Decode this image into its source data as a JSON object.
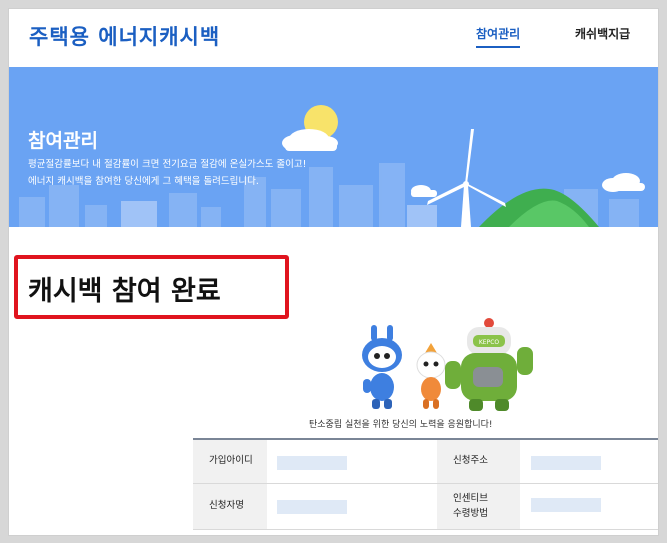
{
  "header": {
    "logo": "주택용 에너지캐시백",
    "nav": [
      {
        "label": "참여관리",
        "active": true
      },
      {
        "label": "캐쉬백지급",
        "active": false
      }
    ]
  },
  "banner": {
    "title": "참여관리",
    "line1": "평균절감률보다 내 절감률이 크면 전기요금 절감에 온실가스도 줄이고!",
    "line2": "에너지 캐시백을 참여한 당신에게 그 혜택을 돌려드립니다."
  },
  "callout": {
    "text": "캐시백 참여 완료",
    "border_color": "#e0141e"
  },
  "mascot": {
    "badge": "KEPCO"
  },
  "cheer_text": "탄소중립 실천을 위한 당신의 노력을 응원합니다!",
  "info_table": {
    "rows": [
      {
        "label_left": "가입아이디",
        "label_right": "신청주소"
      },
      {
        "label_left": "신청자명",
        "label_right_line1": "인센티브",
        "label_right_line2": "수령방법"
      }
    ]
  },
  "colors": {
    "brand": "#1b5fc2",
    "banner_bg": "#6aa3f3",
    "value_placeholder": "#dfe9f6"
  }
}
